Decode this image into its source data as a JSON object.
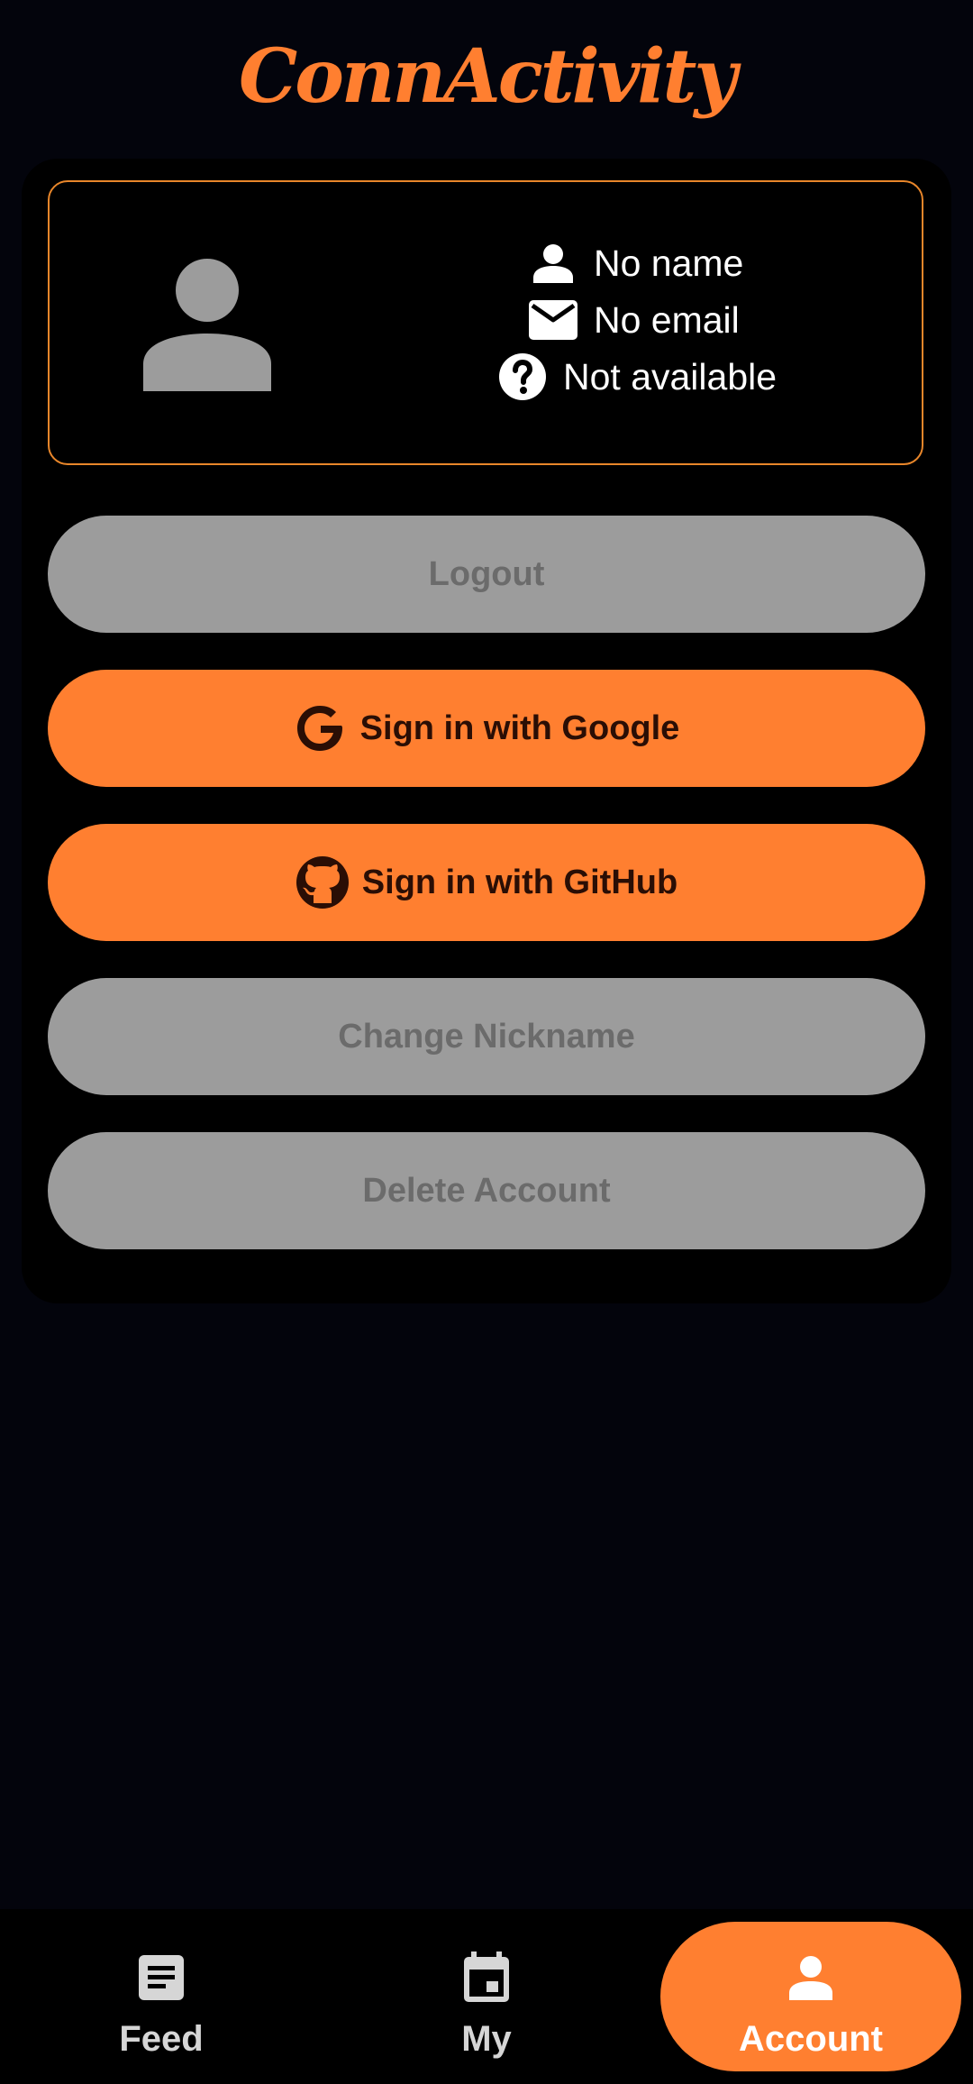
{
  "app": {
    "title": "ConnActivity",
    "accent_color": "#ff7f30",
    "card_border_color": "#e8862a",
    "disabled_color": "#9c9c9c"
  },
  "profile": {
    "avatar_icon": "person-icon",
    "name": "No name",
    "email": "No email",
    "status": "Not available",
    "name_icon": "person-icon",
    "email_icon": "mail-icon",
    "status_icon": "help-circle-icon"
  },
  "buttons": {
    "logout": "Logout",
    "google": "Sign in with Google",
    "google_icon": "google-icon",
    "github": "Sign in with GitHub",
    "github_icon": "github-icon",
    "change_nickname": "Change Nickname",
    "delete_account": "Delete Account"
  },
  "nav": {
    "items": [
      {
        "label": "Feed",
        "icon": "article-icon",
        "active": false
      },
      {
        "label": "My",
        "icon": "calendar-icon",
        "active": false
      },
      {
        "label": "Account",
        "icon": "person-icon",
        "active": true
      }
    ]
  }
}
